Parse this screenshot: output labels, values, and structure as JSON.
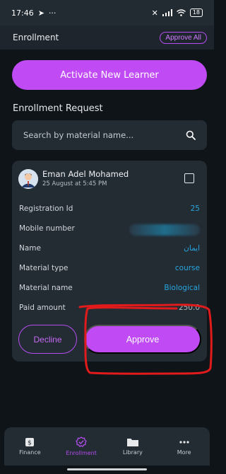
{
  "status": {
    "time": "17:46",
    "battery": "18"
  },
  "header": {
    "title": "Enrollment",
    "approve_all_label": "Approve All"
  },
  "activate_label": "Activate New Learner",
  "section_title": "Enrollment Request",
  "search": {
    "placeholder": "Search by material name..."
  },
  "request": {
    "name": "Eman Adel Mohamed",
    "date": "25 August at 5:45 PM",
    "rows": [
      {
        "label": "Registration Id",
        "value": "25"
      },
      {
        "label": "Mobile number",
        "value": ""
      },
      {
        "label": "Name",
        "value": "ايمان"
      },
      {
        "label": "Material type",
        "value": "course"
      },
      {
        "label": "Material name",
        "value": "Biological"
      },
      {
        "label": "Paid amount",
        "value": "250.0"
      }
    ],
    "decline_label": "Decline",
    "approve_label": "Approve"
  },
  "nav": [
    {
      "label": "Finance",
      "icon": "finance-icon"
    },
    {
      "label": "Enrollment",
      "icon": "enrollment-icon",
      "active": true
    },
    {
      "label": "Library",
      "icon": "folder-icon"
    },
    {
      "label": "More",
      "icon": "more-icon"
    }
  ],
  "colors": {
    "accent": "#c04af4",
    "link": "#27a7e0",
    "background": "#0f1419",
    "card": "#232b33",
    "annotation": "#e11b1b"
  }
}
